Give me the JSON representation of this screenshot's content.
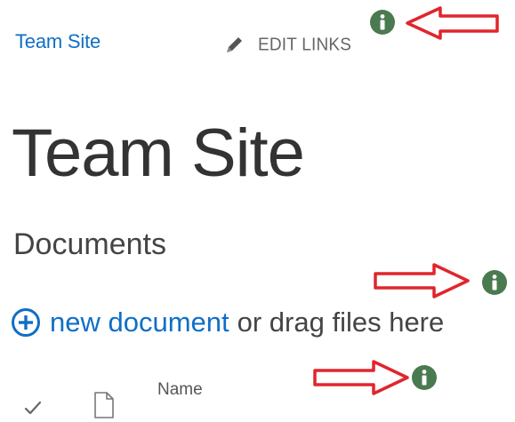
{
  "nav": {
    "site_link": "Team Site",
    "edit_links_label": "EDIT LINKS"
  },
  "page": {
    "title": "Team Site",
    "section_title": "Documents"
  },
  "documents": {
    "new_document_label": "new document",
    "drag_hint": "or drag files here",
    "columns": {
      "name": "Name"
    }
  },
  "colors": {
    "link_blue": "#0f6fc6",
    "info_green": "#4a7a50",
    "arrow_red": "#e0252c"
  },
  "icons": {
    "edit": "pencil-icon",
    "new": "plus-circle-icon",
    "check": "checkmark-icon",
    "file": "document-icon",
    "info": "info-icon",
    "annotation": "red-arrow-icon"
  }
}
